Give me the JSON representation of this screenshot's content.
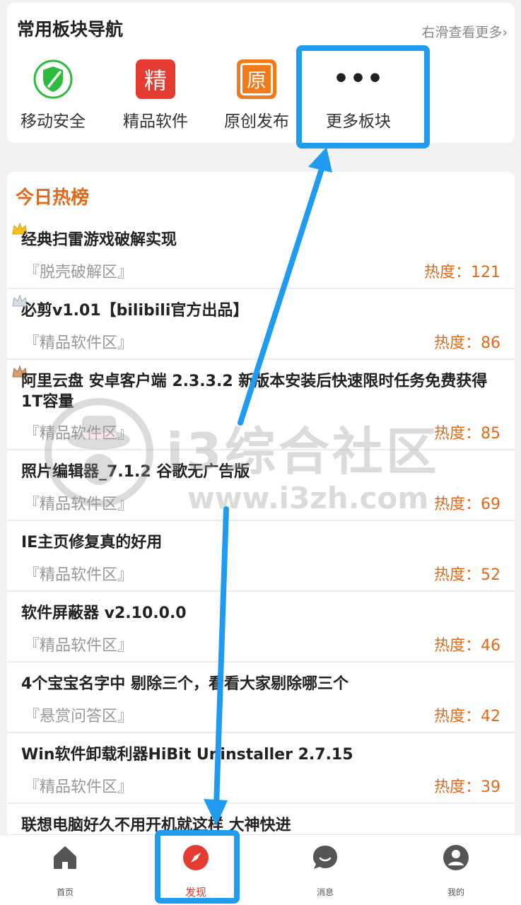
{
  "nav": {
    "title": "常用板块导航",
    "more": "右滑查看更多›",
    "items": [
      {
        "label": "移动安全",
        "icon": "shield-icon",
        "glyph": ""
      },
      {
        "label": "精品软件",
        "icon": "jing-icon",
        "glyph": "精"
      },
      {
        "label": "原创发布",
        "icon": "yuan-icon",
        "glyph": "原"
      },
      {
        "label": "更多板块",
        "icon": "more-dots-icon",
        "glyph": "•••"
      }
    ]
  },
  "hot": {
    "title": "今日热榜",
    "items": [
      {
        "title": "经典扫雷游戏破解实现",
        "section": "『脱壳破解区』",
        "heat": "热度：121"
      },
      {
        "title": "必剪v1.01【bilibili官方出品】",
        "section": "『精品软件区』",
        "heat": "热度：86"
      },
      {
        "title": "阿里云盘 安卓客户端 2.3.3.2 新版本安装后快速限时任务免费获得1T容量",
        "section": "『精品软件区』",
        "heat": "热度：85"
      },
      {
        "title": "照片编辑器_7.1.2 谷歌无广告版",
        "section": "『精品软件区』",
        "heat": "热度：69"
      },
      {
        "title": "IE主页修复真的好用",
        "section": "『精品软件区』",
        "heat": "热度：52"
      },
      {
        "title": "软件屏蔽器 v2.10.0.0",
        "section": "『精品软件区』",
        "heat": "热度：46"
      },
      {
        "title": "4个宝宝名字中 剔除三个，看看大家剔除哪三个",
        "section": "『悬赏问答区』",
        "heat": "热度：42"
      },
      {
        "title": "Win软件卸载利器HiBit Uninstaller 2.7.15",
        "section": "『精品软件区』",
        "heat": "热度：39"
      },
      {
        "title": "联想电脑好久不用开机就这样 大神快进",
        "section": "",
        "heat": ""
      }
    ]
  },
  "watermark": {
    "name": "i3综合社区",
    "url": "www.i3zh.com"
  },
  "tabs": [
    {
      "label": "首页",
      "icon": "home-icon"
    },
    {
      "label": "发现",
      "icon": "compass-icon"
    },
    {
      "label": "消息",
      "icon": "message-icon"
    },
    {
      "label": "我的",
      "icon": "user-icon"
    }
  ],
  "colors": {
    "accent": "#e06a1a",
    "highlight": "#1f9bf0",
    "active_tab": "#e43b32"
  }
}
